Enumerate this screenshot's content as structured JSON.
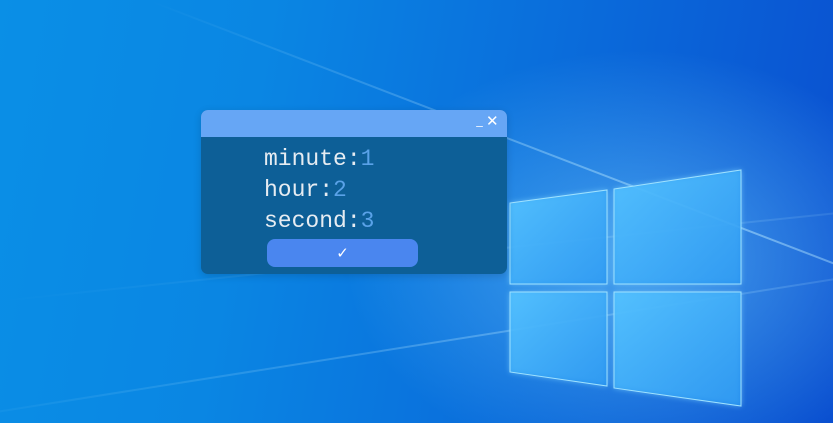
{
  "desktop": {
    "wallpaper": "windows-10-hero",
    "colors": {
      "background_light": "#0a8fe6",
      "background_dark": "#0a4fd0",
      "logo_glow": "#7fd4ff"
    }
  },
  "dialog": {
    "colors": {
      "titlebar": "#66a6f5",
      "body": "#0d5f97",
      "label_text": "#e6ecf2",
      "value_text": "#5aa2e8",
      "button": "#4a86ef"
    },
    "titlebar": {
      "minimize_glyph": "_",
      "minimize_icon": "minimize-icon",
      "close_glyph": "✕",
      "close_icon": "close-icon"
    },
    "fields": [
      {
        "label": "minute:",
        "value": "1"
      },
      {
        "label": "hour:",
        "value": "2"
      },
      {
        "label": "second:",
        "value": "3"
      }
    ],
    "confirm_button": {
      "glyph": "✓",
      "icon": "checkmark-icon"
    }
  }
}
